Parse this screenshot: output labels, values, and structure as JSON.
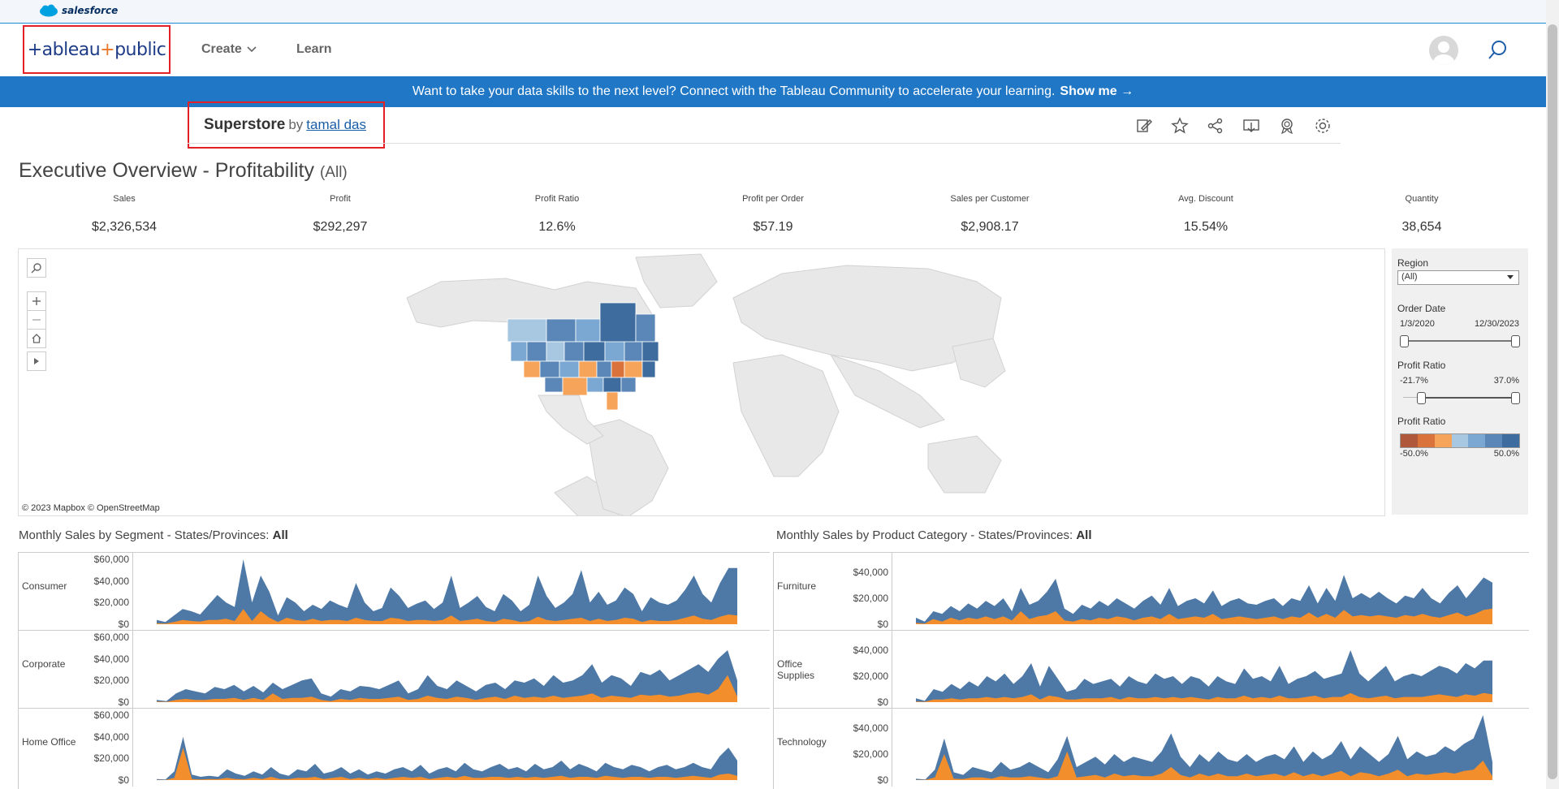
{
  "salesforce": {
    "brand": "salesforce"
  },
  "header": {
    "logo": {
      "part1": "+ableau",
      "plus": "+",
      "part2": "public"
    },
    "nav": [
      {
        "label": "Create"
      },
      {
        "label": "Learn"
      }
    ]
  },
  "banner": {
    "text": "Want to take your data skills to the next level? Connect with the Tableau Community to accelerate your learning.",
    "link": "Show me →"
  },
  "viz": {
    "name": "Superstore",
    "by": "by",
    "author": "tamal das"
  },
  "toolbar": {
    "icons": [
      "edit-icon",
      "star-icon",
      "share-icon",
      "download-icon",
      "badge-icon",
      "gear-icon"
    ]
  },
  "dashboard": {
    "title": "Executive Overview - Profitability",
    "subtitle": "(All)",
    "kpis": [
      {
        "label": "Sales",
        "value": "$2,326,534"
      },
      {
        "label": "Profit",
        "value": "$292,297"
      },
      {
        "label": "Profit Ratio",
        "value": "12.6%"
      },
      {
        "label": "Profit per Order",
        "value": "$57.19"
      },
      {
        "label": "Sales per Customer",
        "value": "$2,908.17"
      },
      {
        "label": "Avg. Discount",
        "value": "15.54%"
      },
      {
        "label": "Quantity",
        "value": "38,654"
      }
    ],
    "map_credit": "© 2023 Mapbox  © OpenStreetMap"
  },
  "filters": {
    "region": {
      "label": "Region",
      "value": "(All)"
    },
    "order_date": {
      "label": "Order Date",
      "start": "1/3/2020",
      "end": "12/30/2023"
    },
    "profit_ratio": {
      "label": "Profit Ratio",
      "min": "-21.7%",
      "max": "37.0%"
    },
    "legend": {
      "label": "Profit Ratio",
      "min": "-50.0%",
      "max": "50.0%",
      "colors": [
        "#b0583c",
        "#d9733b",
        "#f5a45a",
        "#a8c8e2",
        "#7aa8d2",
        "#5b87b8",
        "#3e6c9e"
      ]
    }
  },
  "charts": {
    "left": {
      "title": "Monthly Sales by Segment - States/Provinces:",
      "title_value": "All",
      "rows": [
        {
          "label": "Consumer",
          "ticks": [
            "$60,000",
            "$40,000",
            "$20,000",
            "$0"
          ]
        },
        {
          "label": "Corporate",
          "ticks": [
            "$60,000",
            "$40,000",
            "$20,000",
            "$0"
          ]
        },
        {
          "label": "Home Office",
          "ticks": [
            "$60,000",
            "$40,000",
            "$20,000",
            "$0"
          ]
        }
      ]
    },
    "right": {
      "title": "Monthly Sales by Product Category - States/Provinces:",
      "title_value": "All",
      "rows": [
        {
          "label": "Furniture",
          "ticks": [
            "$40,000",
            "$20,000",
            "$0"
          ]
        },
        {
          "label": "Office Supplies",
          "ticks": [
            "$40,000",
            "$20,000",
            "$0"
          ]
        },
        {
          "label": "Technology",
          "ticks": [
            "$40,000",
            "$20,000",
            "$0"
          ]
        }
      ]
    }
  },
  "chart_data": [
    {
      "type": "area",
      "title": "Monthly Sales by Segment - States/Provinces: All",
      "ylim": [
        0,
        60000
      ],
      "series": [
        {
          "values": [
            4000,
            2000,
            8000,
            14000,
            12000,
            9000,
            18000,
            27000,
            20000,
            16000,
            60000,
            20000,
            45000,
            30000,
            8000,
            25000,
            20000,
            12000,
            18000,
            14000,
            22000,
            18000,
            15000,
            38000,
            20000,
            12000,
            15000,
            34000,
            26000,
            15000,
            19000,
            22000,
            14000,
            20000,
            45000,
            15000,
            20000,
            26000,
            16000,
            12000,
            28000,
            22000,
            12000,
            18000,
            45000,
            26000,
            15000,
            20000,
            28000,
            50000,
            20000,
            30000,
            18000,
            22000,
            34000,
            28000,
            12000,
            25000,
            20000,
            18000,
            22000,
            32000,
            45000,
            28000,
            20000,
            38000,
            52000,
            52000
          ]
        },
        {
          "values": [
            1000,
            500,
            2000,
            4000,
            3000,
            2500,
            4000,
            4000,
            5000,
            3000,
            14000,
            3000,
            12000,
            6000,
            2000,
            6000,
            4000,
            3000,
            5000,
            3000,
            4000,
            4000,
            3000,
            6000,
            4000,
            3000,
            3000,
            6000,
            5000,
            3000,
            4000,
            4000,
            3000,
            4000,
            8000,
            3000,
            4000,
            5000,
            3000,
            2000,
            5000,
            4000,
            2000,
            3000,
            7000,
            4000,
            3000,
            4000,
            5000,
            6000,
            3000,
            5000,
            3000,
            4000,
            6000,
            5000,
            2000,
            4000,
            3000,
            3000,
            4000,
            6000,
            8000,
            5000,
            4000,
            7000,
            9000,
            8000
          ]
        }
      ]
    },
    {
      "type": "area",
      "title": "Monthly Sales by Segment - Corporate",
      "ylim": [
        0,
        60000
      ],
      "series": [
        {
          "values": [
            2000,
            1000,
            8000,
            12000,
            10000,
            8000,
            14000,
            12000,
            16000,
            10000,
            15000,
            9000,
            18000,
            12000,
            16000,
            20000,
            22000,
            8000,
            5000,
            12000,
            10000,
            15000,
            14000,
            12000,
            16000,
            20000,
            8000,
            12000,
            25000,
            15000,
            12000,
            20000,
            15000,
            10000,
            16000,
            18000,
            12000,
            20000,
            18000,
            22000,
            15000,
            25000,
            18000,
            20000,
            25000,
            35000,
            18000,
            25000,
            22000,
            15000,
            28000,
            25000,
            30000,
            20000,
            25000,
            30000,
            35000,
            28000,
            40000,
            48000,
            20000
          ]
        },
        {
          "values": [
            500,
            300,
            2000,
            3000,
            2000,
            2000,
            3000,
            3000,
            4000,
            2000,
            4000,
            2000,
            8000,
            3000,
            4000,
            4000,
            5000,
            2000,
            1000,
            3000,
            2000,
            4000,
            3000,
            3000,
            4000,
            5000,
            2000,
            3000,
            6000,
            4000,
            3000,
            5000,
            4000,
            2000,
            4000,
            5000,
            3000,
            6000,
            4000,
            5000,
            4000,
            6000,
            4000,
            5000,
            6000,
            8000,
            4000,
            6000,
            5000,
            4000,
            7000,
            6000,
            7000,
            5000,
            6000,
            8000,
            9000,
            7000,
            12000,
            25000,
            5000
          ]
        }
      ]
    },
    {
      "type": "area",
      "title": "Monthly Sales by Segment - Home Office",
      "ylim": [
        0,
        60000
      ],
      "series": [
        {
          "values": [
            1000,
            500,
            8000,
            40000,
            5000,
            3000,
            4000,
            3000,
            10000,
            6000,
            4000,
            8000,
            5000,
            12000,
            6000,
            4000,
            10000,
            8000,
            15000,
            6000,
            8000,
            12000,
            6000,
            10000,
            5000,
            8000,
            6000,
            10000,
            12000,
            8000,
            14000,
            6000,
            10000,
            12000,
            8000,
            16000,
            10000,
            8000,
            12000,
            15000,
            10000,
            12000,
            8000,
            15000,
            10000,
            12000,
            18000,
            10000,
            15000,
            12000,
            8000,
            16000,
            12000,
            10000,
            14000,
            12000,
            8000,
            12000,
            14000,
            10000,
            12000,
            16000,
            12000,
            10000,
            22000,
            30000,
            18000
          ]
        },
        {
          "values": [
            200,
            100,
            2000,
            30000,
            1000,
            500,
            1000,
            800,
            2000,
            1000,
            800,
            2000,
            1000,
            3000,
            1000,
            800,
            2000,
            2000,
            3000,
            1000,
            2000,
            3000,
            1000,
            2000,
            1000,
            2000,
            1000,
            2000,
            3000,
            2000,
            3000,
            1000,
            2000,
            3000,
            2000,
            4000,
            2000,
            2000,
            3000,
            3000,
            2000,
            3000,
            2000,
            3000,
            2000,
            3000,
            4000,
            2000,
            3000,
            3000,
            2000,
            4000,
            3000,
            2000,
            3000,
            3000,
            2000,
            3000,
            3000,
            2000,
            3000,
            4000,
            3000,
            2000,
            5000,
            6000,
            4000
          ]
        }
      ]
    },
    {
      "type": "area",
      "title": "Monthly Sales by Product Category - States/Provinces: All",
      "ylim": [
        0,
        50000
      ],
      "series": [
        {
          "values": [
            5000,
            2000,
            10000,
            8000,
            14000,
            10000,
            16000,
            12000,
            18000,
            14000,
            20000,
            10000,
            28000,
            15000,
            18000,
            25000,
            35000,
            12000,
            8000,
            15000,
            12000,
            18000,
            14000,
            20000,
            16000,
            12000,
            18000,
            22000,
            15000,
            28000,
            14000,
            18000,
            20000,
            16000,
            26000,
            14000,
            18000,
            20000,
            16000,
            15000,
            18000,
            20000,
            14000,
            20000,
            18000,
            30000,
            16000,
            28000,
            18000,
            38000,
            20000,
            24000,
            20000,
            25000,
            20000,
            16000,
            22000,
            20000,
            28000,
            20000,
            16000,
            24000,
            30000,
            20000,
            28000,
            36000,
            32000
          ]
        },
        {
          "values": [
            1000,
            500,
            4000,
            2000,
            5000,
            3000,
            5000,
            4000,
            6000,
            4000,
            6000,
            3000,
            10000,
            4000,
            6000,
            7000,
            10000,
            3000,
            2000,
            4000,
            3000,
            5000,
            4000,
            6000,
            5000,
            3000,
            5000,
            6000,
            4000,
            8000,
            4000,
            5000,
            6000,
            5000,
            8000,
            4000,
            5000,
            6000,
            5000,
            4000,
            5000,
            6000,
            4000,
            6000,
            5000,
            9000,
            5000,
            8000,
            5000,
            11000,
            6000,
            7000,
            6000,
            7000,
            6000,
            5000,
            7000,
            6000,
            8000,
            6000,
            5000,
            7000,
            9000,
            6000,
            8000,
            11000,
            12000
          ]
        }
      ]
    },
    {
      "type": "area",
      "title": "Monthly Sales by Product Category - Office Supplies",
      "ylim": [
        0,
        50000
      ],
      "series": [
        {
          "values": [
            3000,
            1000,
            10000,
            8000,
            14000,
            10000,
            16000,
            12000,
            20000,
            16000,
            22000,
            14000,
            20000,
            30000,
            12000,
            28000,
            18000,
            8000,
            10000,
            18000,
            14000,
            16000,
            18000,
            12000,
            20000,
            16000,
            14000,
            22000,
            18000,
            20000,
            14000,
            20000,
            18000,
            12000,
            20000,
            16000,
            14000,
            26000,
            18000,
            20000,
            16000,
            28000,
            14000,
            18000,
            20000,
            24000,
            18000,
            20000,
            22000,
            40000,
            22000,
            16000,
            22000,
            28000,
            16000,
            20000,
            22000,
            20000,
            24000,
            28000,
            26000,
            22000,
            30000,
            26000,
            32000,
            32000
          ]
        },
        {
          "values": [
            500,
            300,
            2000,
            2000,
            3000,
            2000,
            3000,
            3000,
            4000,
            3000,
            4000,
            3000,
            4000,
            6000,
            2000,
            5000,
            4000,
            2000,
            2000,
            3000,
            3000,
            3000,
            4000,
            2000,
            4000,
            3000,
            3000,
            4000,
            3000,
            4000,
            3000,
            4000,
            3000,
            2000,
            4000,
            3000,
            3000,
            5000,
            3000,
            4000,
            3000,
            5000,
            3000,
            3000,
            4000,
            5000,
            3000,
            4000,
            4000,
            7000,
            4000,
            3000,
            4000,
            5000,
            3000,
            4000,
            4000,
            4000,
            5000,
            6000,
            5000,
            4000,
            6000,
            5000,
            7000,
            6000
          ]
        }
      ]
    },
    {
      "type": "area",
      "title": "Monthly Sales by Product Category - Technology",
      "ylim": [
        0,
        50000
      ],
      "series": [
        {
          "values": [
            1000,
            500,
            8000,
            32000,
            6000,
            4000,
            10000,
            8000,
            6000,
            14000,
            8000,
            10000,
            14000,
            10000,
            6000,
            16000,
            34000,
            10000,
            14000,
            18000,
            12000,
            20000,
            14000,
            18000,
            16000,
            14000,
            22000,
            36000,
            18000,
            10000,
            20000,
            14000,
            22000,
            16000,
            14000,
            20000,
            14000,
            18000,
            20000,
            16000,
            26000,
            14000,
            22000,
            16000,
            20000,
            30000,
            16000,
            26000,
            20000,
            14000,
            20000,
            34000,
            16000,
            22000,
            18000,
            20000,
            26000,
            22000,
            28000,
            32000,
            52000,
            14000
          ]
        },
        {
          "values": [
            200,
            100,
            2000,
            20000,
            1000,
            800,
            2000,
            2000,
            1000,
            3000,
            2000,
            2000,
            3000,
            2000,
            1000,
            3000,
            22000,
            2000,
            3000,
            4000,
            2000,
            5000,
            3000,
            4000,
            3000,
            3000,
            5000,
            10000,
            4000,
            2000,
            5000,
            3000,
            5000,
            3000,
            3000,
            5000,
            3000,
            4000,
            5000,
            3000,
            6000,
            3000,
            5000,
            3000,
            5000,
            7000,
            3000,
            6000,
            5000,
            3000,
            5000,
            8000,
            3000,
            5000,
            4000,
            5000,
            6000,
            5000,
            7000,
            8000,
            15000,
            3000
          ]
        }
      ]
    }
  ]
}
